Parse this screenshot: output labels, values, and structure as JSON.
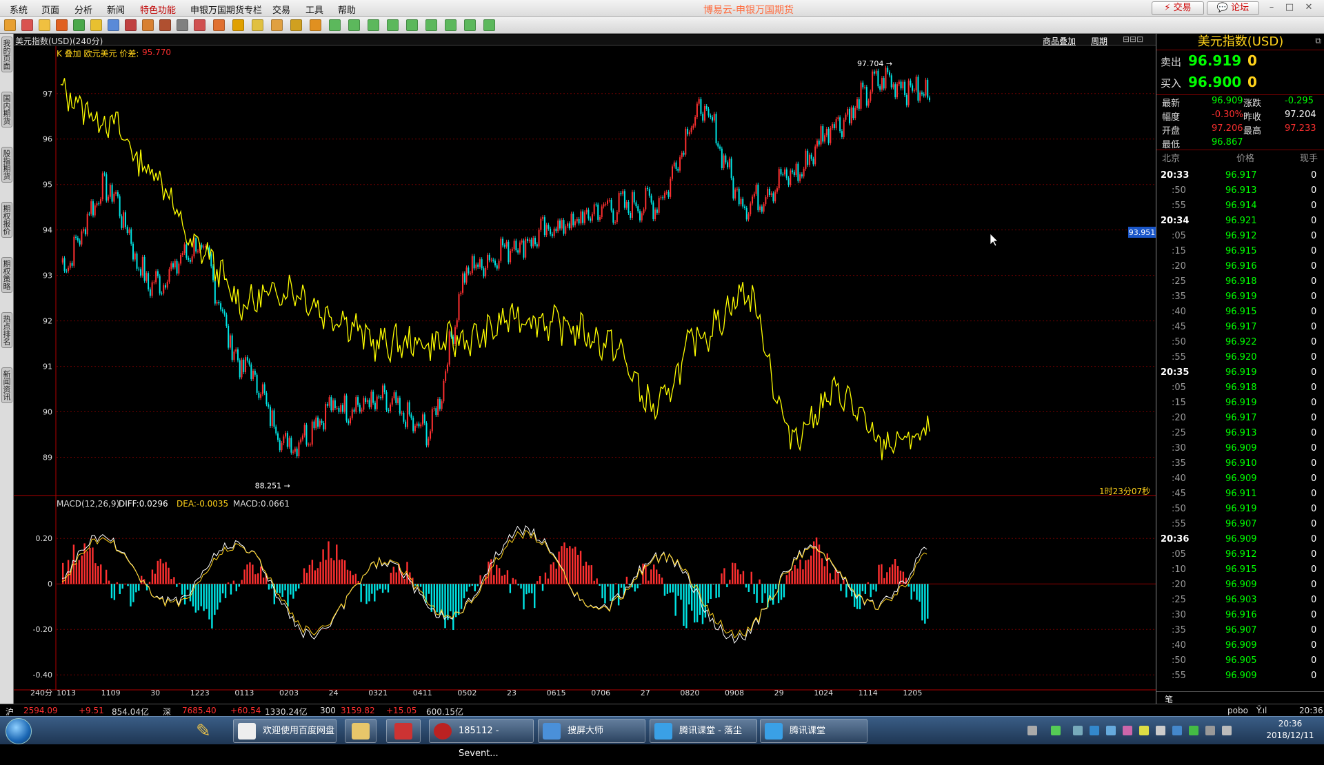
{
  "menu": {
    "items": [
      "系统",
      "页面",
      "分析",
      "新闻",
      "特色功能",
      "申银万国期货专栏",
      "交易",
      "工具",
      "帮助"
    ],
    "highlight": "特色功能"
  },
  "app_title": "博易云-申银万国期货",
  "top_buttons": {
    "trade": "交易",
    "forum": "论坛"
  },
  "side_tabs": [
    "我的页面",
    "国内期货",
    "股指期货",
    "期权报价",
    "期权策略",
    "热点排名",
    "新闻资讯"
  ],
  "chart": {
    "title": "美元指数(USD)(240分)",
    "header_right": [
      "商品叠加",
      "周期"
    ],
    "overlay_label": "K 叠加 欧元美元 价差:",
    "overlay_value": "95.770",
    "high_label": "97.704",
    "low_label": "88.251",
    "crosshair_value": "93.951",
    "countdown": "1时23分07秒",
    "macd_label": "MACD(12,26,9)",
    "macd_diff": "DIFF:0.0296",
    "macd_dea": "DEA:-0.0035",
    "macd_macd": "MACD:0.0661",
    "period_label": "240分",
    "colors": {
      "up": "#ff3030",
      "down": "#00e5e5",
      "overlay": "#ffff00",
      "grid": "#6e0000"
    }
  },
  "chart_data": [
    {
      "type": "line",
      "title": "美元指数(USD)(240分)",
      "x": [
        "1013",
        "1109",
        "30",
        "1223",
        "0113",
        "0203",
        "24",
        "0321",
        "0411",
        "0502",
        "23",
        "0615",
        "0706",
        "27",
        "0820",
        "0908",
        "29",
        "1024",
        "1114",
        "1205"
      ],
      "series": [
        {
          "name": "美元指数(USD)",
          "values": [
            93.2,
            94.9,
            92.8,
            93.6,
            91.0,
            89.3,
            90.1,
            90.2,
            89.6,
            93.2,
            93.7,
            94.1,
            94.5,
            94.6,
            96.6,
            94.6,
            95.2,
            96.4,
            97.3,
            97.0
          ]
        },
        {
          "name": "欧元美元",
          "values": [
            97.0,
            96.4,
            95.3,
            93.6,
            92.4,
            92.7,
            92.1,
            91.5,
            91.5,
            91.6,
            92.1,
            91.9,
            91.5,
            90.1,
            91.7,
            92.6,
            89.5,
            90.4,
            89.3,
            89.5
          ]
        }
      ],
      "y_ticks": [
        97,
        96,
        95,
        94,
        93,
        92,
        91,
        90,
        89
      ],
      "ylim": [
        88.25,
        97.8
      ],
      "annotations": [
        "97.704",
        "88.251",
        "93.951"
      ]
    },
    {
      "type": "bar",
      "title": "MACD(12,26,9)",
      "y_ticks": [
        "0.20",
        "0",
        "-0.20",
        "-0.40"
      ],
      "ylim": [
        -0.46,
        0.34
      ],
      "series": [
        {
          "name": "DIFF",
          "values": [
            0.0296
          ]
        },
        {
          "name": "DEA",
          "values": [
            -0.0035
          ]
        },
        {
          "name": "MACD",
          "values": [
            0.0661
          ]
        }
      ]
    }
  ],
  "quote": {
    "title": "美元指数(USD)",
    "sell_label": "卖出",
    "sell_price": "96.919",
    "sell_vol": "0",
    "buy_label": "买入",
    "buy_price": "96.900",
    "buy_vol": "0",
    "rows": [
      [
        "最新",
        "96.909",
        "涨跌",
        "-0.295"
      ],
      [
        "幅度",
        "-0.30%",
        "昨收",
        "97.204"
      ],
      [
        "开盘",
        "97.206",
        "最高",
        "97.233"
      ],
      [
        "最低",
        "96.867",
        "",
        ""
      ]
    ],
    "tick_headers": [
      "北京",
      "价格",
      "现手"
    ],
    "ticks": [
      [
        "20:33",
        "96.917",
        "0"
      ],
      [
        ":50",
        "96.913",
        "0"
      ],
      [
        ":55",
        "96.914",
        "0"
      ],
      [
        "20:34",
        "96.921",
        "0"
      ],
      [
        ":05",
        "96.912",
        "0"
      ],
      [
        ":15",
        "96.915",
        "0"
      ],
      [
        ":20",
        "96.916",
        "0"
      ],
      [
        ":25",
        "96.918",
        "0"
      ],
      [
        ":35",
        "96.919",
        "0"
      ],
      [
        ":40",
        "96.915",
        "0"
      ],
      [
        ":45",
        "96.917",
        "0"
      ],
      [
        ":50",
        "96.922",
        "0"
      ],
      [
        ":55",
        "96.920",
        "0"
      ],
      [
        "20:35",
        "96.919",
        "0"
      ],
      [
        ":05",
        "96.918",
        "0"
      ],
      [
        ":15",
        "96.919",
        "0"
      ],
      [
        ":20",
        "96.917",
        "0"
      ],
      [
        ":25",
        "96.913",
        "0"
      ],
      [
        ":30",
        "96.909",
        "0"
      ],
      [
        ":35",
        "96.910",
        "0"
      ],
      [
        ":40",
        "96.909",
        "0"
      ],
      [
        ":45",
        "96.911",
        "0"
      ],
      [
        ":50",
        "96.919",
        "0"
      ],
      [
        ":55",
        "96.907",
        "0"
      ],
      [
        "20:36",
        "96.909",
        "0"
      ],
      [
        ":05",
        "96.912",
        "0"
      ],
      [
        ":10",
        "96.915",
        "0"
      ],
      [
        ":20",
        "96.909",
        "0"
      ],
      [
        ":25",
        "96.903",
        "0"
      ],
      [
        ":30",
        "96.916",
        "0"
      ],
      [
        ":35",
        "96.907",
        "0"
      ],
      [
        ":40",
        "96.909",
        "0"
      ],
      [
        ":50",
        "96.905",
        "0"
      ],
      [
        ":55",
        "96.909",
        "0"
      ]
    ],
    "footer_label": "笔"
  },
  "status": {
    "sh_label": "沪",
    "sh_index": "2594.09",
    "sh_change": "+9.51",
    "sh_amount": "854.04亿",
    "sz_label": "深",
    "sz_index": "7685.40",
    "sz_change": "+60.54",
    "sz_amount": "1330.24亿",
    "hs300_label": "300",
    "hs300_index": "3159.82",
    "hs300_change": "+15.05",
    "hs300_amount": "600.15亿",
    "user": "pobo",
    "time": "20:36"
  },
  "taskbar": {
    "tasks": [
      "欢迎使用百度网盘",
      "185112 - Sevent...",
      "搜屏大师",
      "腾讯课堂 - 落尘",
      "腾讯课堂"
    ],
    "clock_time": "20:36",
    "clock_date": "2018/12/11"
  }
}
